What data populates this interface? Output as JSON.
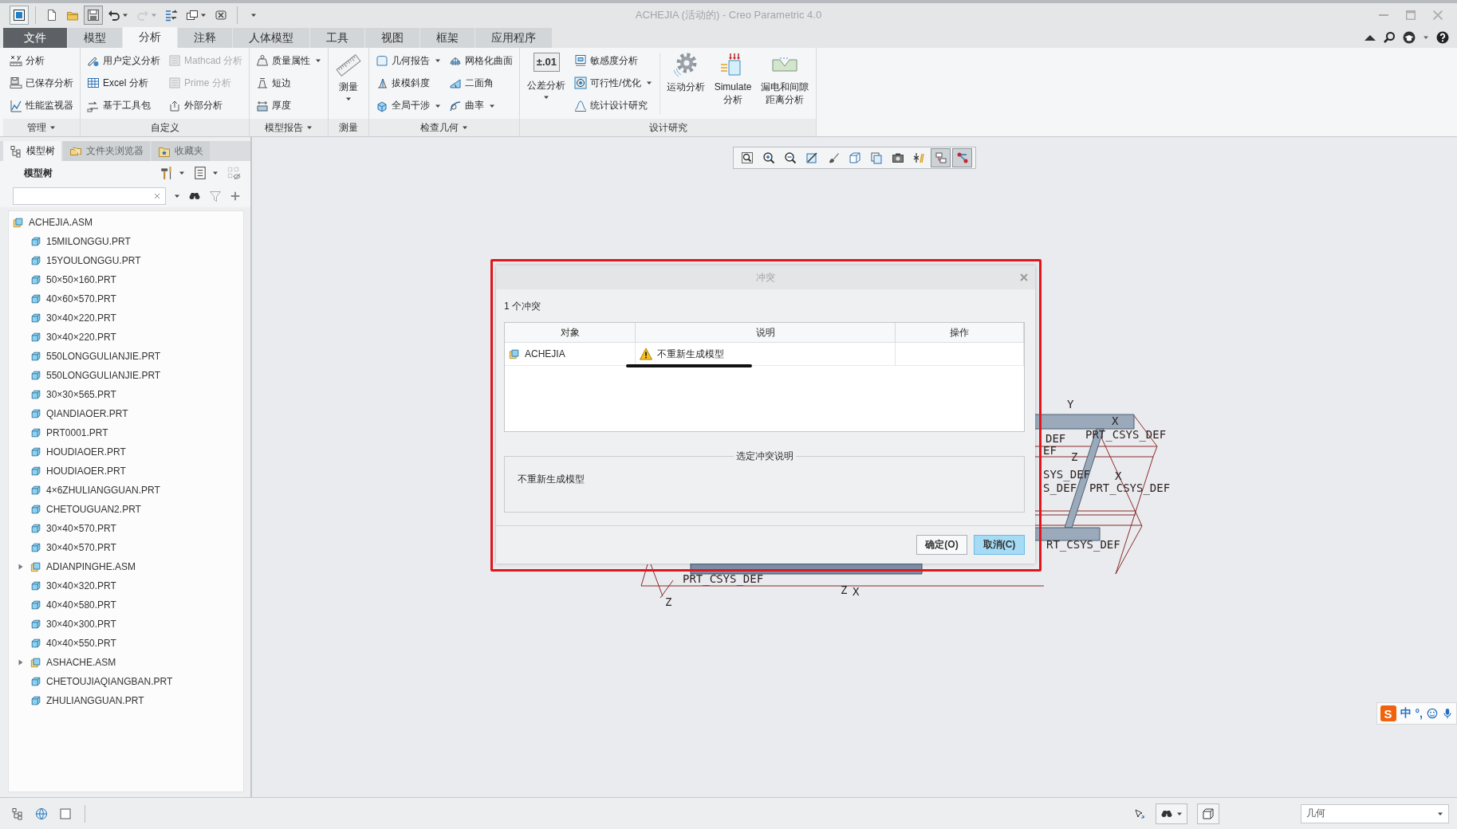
{
  "window": {
    "title": "ACHEJIA (活动的) - Creo Parametric 4.0"
  },
  "quick_access": [
    {
      "kind": "new",
      "menu": false,
      "disabled": false,
      "hovered": false
    },
    {
      "kind": "open",
      "menu": false,
      "disabled": false,
      "hovered": false
    },
    {
      "kind": "save",
      "menu": false,
      "disabled": false,
      "hovered": true
    },
    {
      "kind": "undo",
      "menu": true,
      "disabled": false,
      "hovered": false
    },
    {
      "kind": "redo",
      "menu": true,
      "disabled": true,
      "hovered": false
    },
    {
      "kind": "regenerate",
      "menu": false,
      "disabled": false,
      "hovered": false
    },
    {
      "kind": "windows",
      "menu": true,
      "disabled": false,
      "hovered": false
    },
    {
      "kind": "close",
      "menu": false,
      "disabled": false,
      "hovered": false
    }
  ],
  "ribbon_tabs": [
    {
      "label": "文件",
      "kind": "file",
      "selected": false
    },
    {
      "label": "模型",
      "kind": "tab",
      "selected": false
    },
    {
      "label": "分析",
      "kind": "tab",
      "selected": true
    },
    {
      "label": "注释",
      "kind": "tab",
      "selected": false
    },
    {
      "label": "人体模型",
      "kind": "tab",
      "selected": false
    },
    {
      "label": "工具",
      "kind": "tab",
      "selected": false
    },
    {
      "label": "视图",
      "kind": "tab",
      "selected": false
    },
    {
      "label": "框架",
      "kind": "tab",
      "selected": false
    },
    {
      "label": "应用程序",
      "kind": "tab",
      "selected": false
    }
  ],
  "ribbon_groups": [
    {
      "label": "管理",
      "menu": true,
      "columns": [
        {
          "kind": "stack",
          "items": [
            {
              "label": "分析",
              "menu": false,
              "disabled": false
            },
            {
              "label": "已保存分析",
              "menu": false,
              "disabled": false
            },
            {
              "label": "性能监视器",
              "menu": false,
              "disabled": false
            }
          ]
        }
      ]
    },
    {
      "label": "自定义",
      "menu": false,
      "columns": [
        {
          "kind": "stack",
          "items": [
            {
              "label": "用户定义分析",
              "menu": false,
              "disabled": false
            },
            {
              "label": "Excel 分析",
              "menu": false,
              "disabled": false
            },
            {
              "label": "基于工具包",
              "menu": false,
              "disabled": false
            }
          ]
        },
        {
          "kind": "stack",
          "items": [
            {
              "label": "Mathcad 分析",
              "menu": false,
              "disabled": true
            },
            {
              "label": "Prime 分析",
              "menu": false,
              "disabled": true
            },
            {
              "label": "外部分析",
              "menu": false,
              "disabled": false
            }
          ]
        }
      ]
    },
    {
      "label": "模型报告",
      "menu": true,
      "columns": [
        {
          "kind": "stack",
          "items": [
            {
              "label": "质量属性",
              "menu": true,
              "disabled": false
            },
            {
              "label": "短边",
              "menu": false,
              "disabled": false
            },
            {
              "label": "厚度",
              "menu": false,
              "disabled": false
            }
          ]
        }
      ]
    },
    {
      "label": "测量",
      "menu": false,
      "columns": [
        {
          "kind": "large",
          "items": [
            {
              "label": "测量",
              "menu": true,
              "disabled": false
            }
          ]
        }
      ]
    },
    {
      "label": "检查几何",
      "menu": true,
      "columns": [
        {
          "kind": "stack",
          "items": [
            {
              "label": "几何报告",
              "menu": true,
              "disabled": false
            },
            {
              "label": "拔模斜度",
              "menu": false,
              "disabled": false
            },
            {
              "label": "全局干涉",
              "menu": true,
              "disabled": false
            }
          ]
        },
        {
          "kind": "stack",
          "items": [
            {
              "label": "网格化曲面",
              "menu": false,
              "disabled": false
            },
            {
              "label": "二面角",
              "menu": false,
              "disabled": false
            },
            {
              "label": "曲率",
              "menu": true,
              "disabled": false
            }
          ]
        }
      ]
    },
    {
      "label": "设计研究",
      "menu": false,
      "columns": [
        {
          "kind": "large",
          "items": [
            {
              "label": "公差分析",
              "tag": "±.01",
              "menu": true,
              "disabled": false
            }
          ]
        },
        {
          "kind": "stack",
          "items": [
            {
              "label": "敏感度分析",
              "menu": false,
              "disabled": false
            },
            {
              "label": "可行性/优化",
              "menu": true,
              "disabled": false
            },
            {
              "label": "统计设计研究",
              "menu": false,
              "disabled": false
            }
          ]
        },
        {
          "kind": "large",
          "items": [
            {
              "label": "运动分析",
              "menu": false,
              "disabled": false
            }
          ]
        },
        {
          "kind": "large",
          "items": [
            {
              "label": "Simulate\n分析",
              "menu": false,
              "disabled": false
            }
          ]
        },
        {
          "kind": "large",
          "items": [
            {
              "label": "漏电和间隙距离分析",
              "menu": false,
              "disabled": false
            }
          ]
        }
      ]
    }
  ],
  "left_panel": {
    "tabs": [
      {
        "label": "模型树",
        "selected": true
      },
      {
        "label": "文件夹浏览器",
        "selected": false
      },
      {
        "label": "收藏夹",
        "selected": false
      }
    ],
    "title": "模型树",
    "tree": [
      {
        "label": "ACHEJIA.ASM",
        "kind": "asm",
        "children": [
          {
            "label": "15MILONGGU.PRT",
            "kind": "prt"
          },
          {
            "label": "15YOULONGGU.PRT",
            "kind": "prt"
          },
          {
            "label": "50×50×160.PRT",
            "kind": "prt"
          },
          {
            "label": "40×60×570.PRT",
            "kind": "prt"
          },
          {
            "label": "30×40×220.PRT",
            "kind": "prt"
          },
          {
            "label": "30×40×220.PRT",
            "kind": "prt"
          },
          {
            "label": "550LONGGULIANJIE.PRT",
            "kind": "prt"
          },
          {
            "label": "550LONGGULIANJIE.PRT",
            "kind": "prt"
          },
          {
            "label": "30×30×565.PRT",
            "kind": "prt"
          },
          {
            "label": "QIANDIAOER.PRT",
            "kind": "prt"
          },
          {
            "label": "PRT0001.PRT",
            "kind": "prt"
          },
          {
            "label": "HOUDIAOER.PRT",
            "kind": "prt"
          },
          {
            "label": "HOUDIAOER.PRT",
            "kind": "prt"
          },
          {
            "label": "4×6ZHULIANGGUAN.PRT",
            "kind": "prt"
          },
          {
            "label": "CHETOUGUAN2.PRT",
            "kind": "prt"
          },
          {
            "label": "30×40×570.PRT",
            "kind": "prt"
          },
          {
            "label": "30×40×570.PRT",
            "kind": "prt"
          },
          {
            "label": "ADIANPINGHE.ASM",
            "kind": "asm",
            "expanded": false
          },
          {
            "label": "30×40×320.PRT",
            "kind": "prt"
          },
          {
            "label": "40×40×580.PRT",
            "kind": "prt"
          },
          {
            "label": "30×40×300.PRT",
            "kind": "prt"
          },
          {
            "label": "40×40×550.PRT",
            "kind": "prt"
          },
          {
            "label": "ASHACHE.ASM",
            "kind": "asm",
            "expanded": false
          },
          {
            "label": "CHETOUJIAQIANGBAN.PRT",
            "kind": "prt"
          },
          {
            "label": "ZHULIANGGUAN.PRT",
            "kind": "prt"
          }
        ]
      }
    ]
  },
  "view_toolbar": [
    {
      "kind": "refit",
      "pressed": false
    },
    {
      "kind": "zoom_in",
      "pressed": false
    },
    {
      "kind": "zoom_out",
      "pressed": false
    },
    {
      "kind": "repaint",
      "pressed": false
    },
    {
      "kind": "view_manager",
      "pressed": false
    },
    {
      "kind": "display_style",
      "pressed": false
    },
    {
      "kind": "saved_orientations",
      "pressed": false
    },
    {
      "kind": "named_views",
      "pressed": false
    },
    {
      "kind": "datum_display",
      "pressed": false
    },
    {
      "kind": "spin_center",
      "pressed": true
    },
    {
      "kind": "annotation_display",
      "pressed": true
    }
  ],
  "viewport": {
    "labels": [
      "Y",
      "X",
      "DEF",
      "PRT_CSYS_DEF",
      "EF",
      "Z",
      "SYS_DEF",
      "X",
      "S_DEF",
      "PRT_CSYS_DEF",
      "RT_CSYS_DEF",
      "PRT_CSYS_DEF",
      "Z",
      "X",
      "Z"
    ]
  },
  "dialog": {
    "title": "冲突",
    "summary": "1 个冲突",
    "columns": [
      "对象",
      "说明",
      "操作"
    ],
    "rows": [
      {
        "object": "ACHEJIA",
        "description": "不重新生成模型"
      }
    ],
    "details_title": "选定冲突说明",
    "details": "不重新生成模型",
    "buttons": [
      {
        "label": "确定(O)",
        "focused": false
      },
      {
        "label": "取消(C)",
        "focused": true
      }
    ]
  },
  "status_bar": {
    "filter": "几何"
  },
  "ime_bar": {
    "logo": "S",
    "mode": "中",
    "punctuation": "°,"
  }
}
